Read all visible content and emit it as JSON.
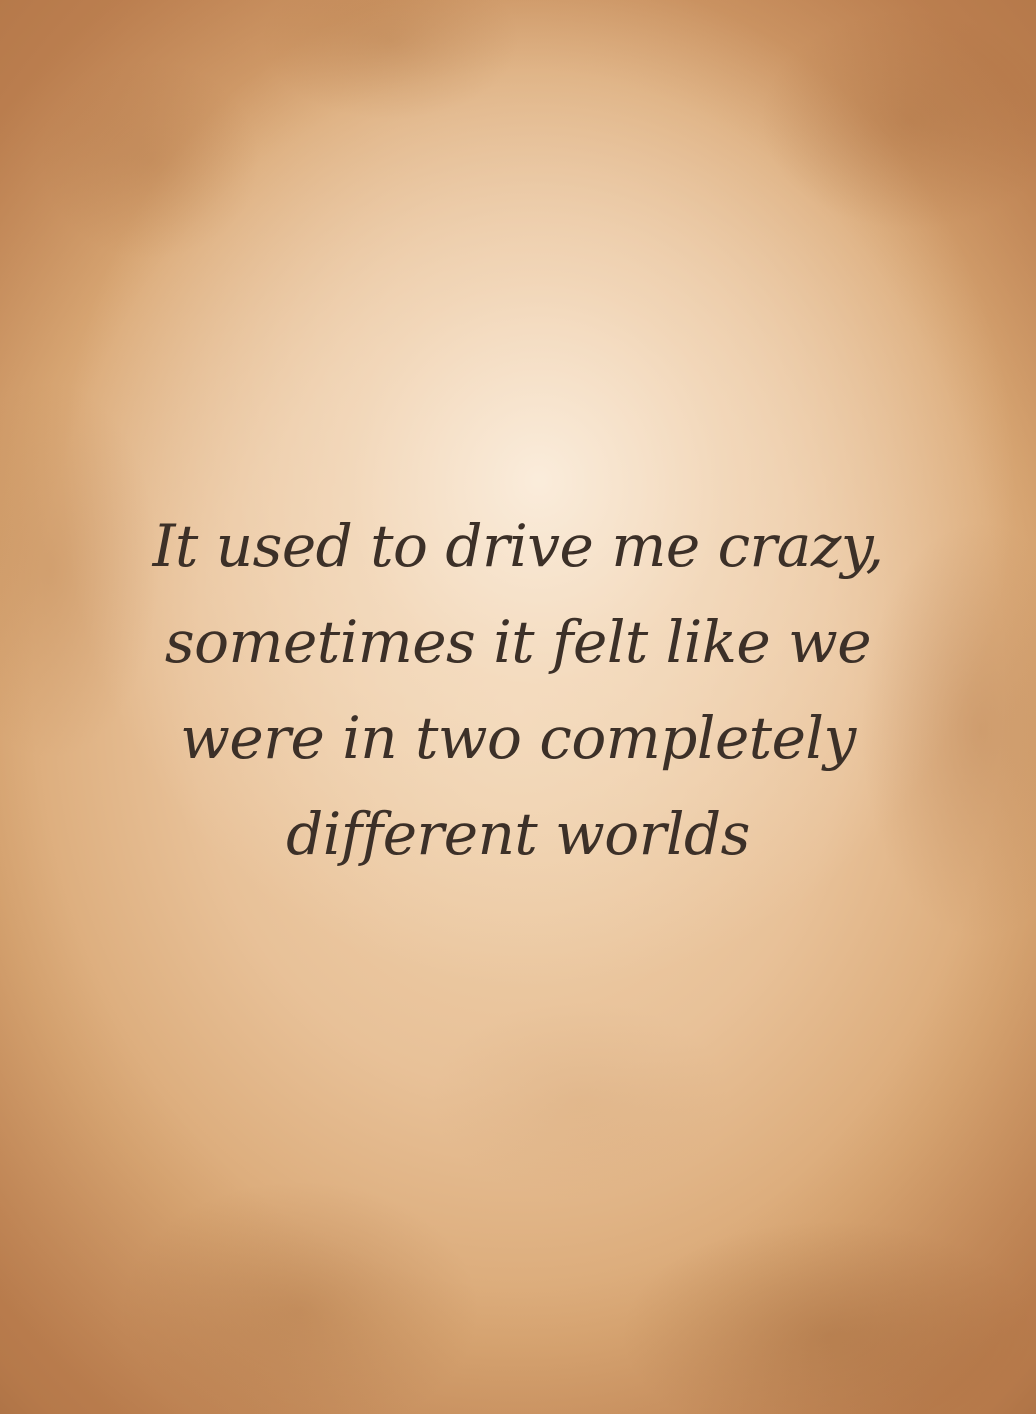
{
  "quote": {
    "lines": [
      "It used to drive me crazy,",
      "sometimes it felt like we",
      "were in two completely",
      "different worlds"
    ]
  },
  "colors": {
    "parchment_light": "#f7e6d0",
    "parchment_mid": "#e8c198",
    "parchment_edge": "#c78a5a",
    "text": "#3c3028"
  }
}
